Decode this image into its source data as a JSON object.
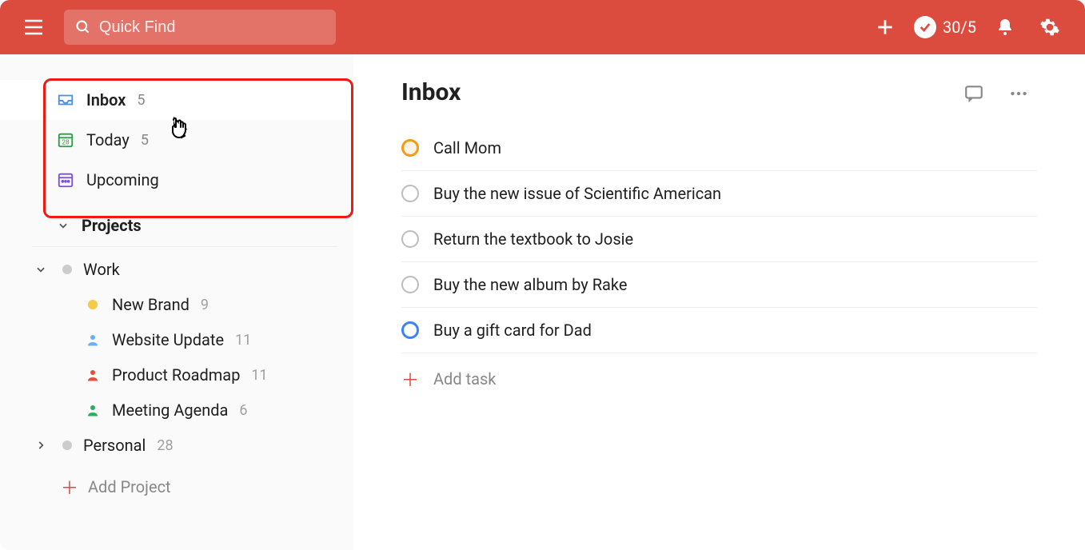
{
  "header": {
    "search_placeholder": "Quick Find",
    "karma_score": "30/5"
  },
  "sidebar": {
    "nav": [
      {
        "label": "Inbox",
        "count": "5"
      },
      {
        "label": "Today",
        "count": "5"
      },
      {
        "label": "Upcoming",
        "count": ""
      }
    ],
    "projects_header": "Projects",
    "groups": [
      {
        "label": "Work",
        "expanded": true,
        "items": [
          {
            "label": "New Brand",
            "count": "9",
            "icon": "yellow-dot"
          },
          {
            "label": "Website Update",
            "count": "11",
            "icon": "person-blue"
          },
          {
            "label": "Product Roadmap",
            "count": "11",
            "icon": "person-red"
          },
          {
            "label": "Meeting Agenda",
            "count": "6",
            "icon": "person-green"
          }
        ]
      },
      {
        "label": "Personal",
        "count": "28",
        "expanded": false,
        "items": []
      }
    ],
    "add_project_label": "Add Project"
  },
  "main": {
    "title": "Inbox",
    "tasks": [
      {
        "title": "Call Mom",
        "priority": "orange"
      },
      {
        "title": "Buy the new issue of Scientific American",
        "priority": ""
      },
      {
        "title": "Return the textbook to Josie",
        "priority": ""
      },
      {
        "title": "Buy the new album by Rake",
        "priority": ""
      },
      {
        "title": "Buy a gift card for Dad",
        "priority": "blue"
      }
    ],
    "add_task_label": "Add task"
  }
}
